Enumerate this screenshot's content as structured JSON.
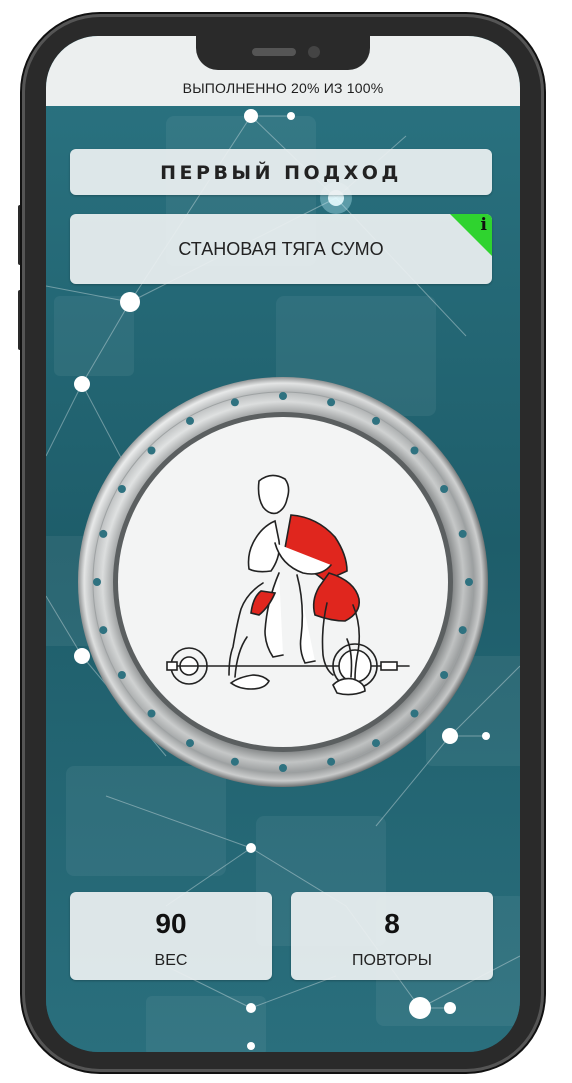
{
  "status": {
    "progress_text": "ВЫПОЛНЕННО 20% ИЗ 100%",
    "progress_percent": 20
  },
  "set": {
    "title": "ПЕРВЫЙ ПОДХОД"
  },
  "exercise": {
    "name": "СТАНОВАЯ ТЯГА СУМО",
    "info_icon": "info-icon",
    "info_glyph": "i",
    "info_color": "#2fd32f"
  },
  "illustration": {
    "icon": "sumo-deadlift-figure",
    "highlight_color": "#e0261e"
  },
  "stats": {
    "weight_value": "90",
    "weight_label": "ВЕС",
    "reps_value": "8",
    "reps_label": "ПОВТОРЫ"
  },
  "colors": {
    "background": "#1f5f6c",
    "card": "#ecf0f1",
    "frame": "#2a2a2a"
  }
}
